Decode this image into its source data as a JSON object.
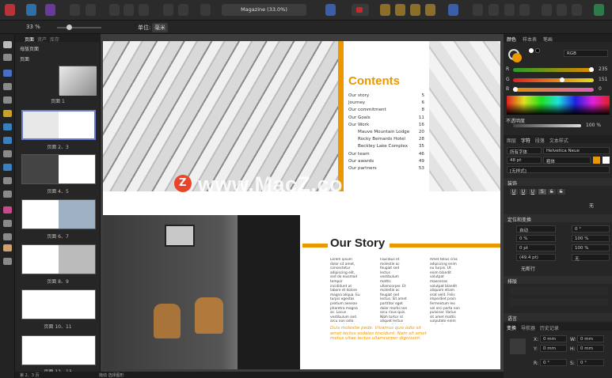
{
  "toolbar": {
    "doc_title": "Magazine (33.0%)"
  },
  "context": {
    "zoom": "33 %",
    "unit_label": "单位:",
    "unit_value": "毫米"
  },
  "pages_panel": {
    "tabs": [
      "页面",
      "资产",
      "库存"
    ],
    "master_label": "母版页面",
    "pages_label": "页面",
    "thumbs": [
      "页面 1",
      "页面 2、3",
      "页面 4、5",
      "页面 6、7",
      "页面 8、9",
      "页面 10、11",
      "页面 12、13"
    ]
  },
  "spread_toc": {
    "heading": "Contents",
    "items": [
      {
        "label": "Our story",
        "page": "5"
      },
      {
        "label": "Journey",
        "page": "6"
      },
      {
        "label": "Our commitment",
        "page": "8"
      },
      {
        "label": "Our Goals",
        "page": "11"
      },
      {
        "label": "Our Work",
        "page": "16"
      },
      {
        "label": "Mauve Mountain Lodge",
        "page": "20"
      },
      {
        "label": "Rocky Bernards Hotel",
        "page": "28"
      },
      {
        "label": "Beckley Lake Complex",
        "page": "35"
      },
      {
        "label": "Our team",
        "page": "46"
      },
      {
        "label": "Our awards",
        "page": "49"
      },
      {
        "label": "Our partners",
        "page": "53"
      }
    ]
  },
  "spread_story": {
    "heading": "Our Story",
    "col1": "Lorem ipsum dolor sit amet, consectetur adipiscing elit, sed do eiusmod tempor incididunt ut labore et dolore magna aliqua. Eu turpis egestas pretium aenean pharetra magna ac. Lacus vestibulum sed arcu non odio euismod lacinia. Tempus imperdiet nulla malesuada pellentesque elit eget gravida cum sociis natoque penatibus. Aliquam sem et tortor consequat id porta nibh venenatis cras sed felis eget.",
    "col2": "Faucibus et molestie ac feugiat sed lectus vestibulum mattis ullamcorper. Et molestie ac feugiat sed lectus. Sit amet porttitor eget dolor morbi non arcu risus quis. Nibh tortor id aliquet lectus proin nibh nisl condimentum id venenatis a. Cursus turpis massa tincidunt dui ut ornare lectus sit amet. Mauris sit amet massa vitae tortor condimentum lacinia quis vel eros.",
    "col3": "Amet tellus cras adipiscing enim eu turpis. Ut enim blandit volutpat maecenas volutpat blandit aliquam etiam erat velit. Felis imperdiet proin fermentum leo vel orci porta non pulvinar. Varius sit amet mattis vulputate enim nulla aliquet porttitor. Egestas maecenas pharetra convallis posuere morbi leo urna molestie.",
    "quote": "Duis molestie pede. Vivamus quis odio sit amet lectus sodales tincidunt. Nam sit amet metus vitae lectus ullamcorper dignissim."
  },
  "watermark": "www.MacZ.com",
  "right_panel": {
    "tabs1": [
      "颜色",
      "样本表",
      "笔画"
    ],
    "color_mode": "RGB",
    "r_label": "R",
    "r_value": "235",
    "g_label": "G",
    "g_value": "151",
    "b_label": "B",
    "b_value": "0",
    "opacity_label": "不透明度",
    "opacity_value": "100 %",
    "tabs2": [
      "图层",
      "字符",
      "段落",
      "文本样式"
    ],
    "font_lang": "所有字体",
    "font_name": "Helvetica Neue",
    "font_size": "48 pt",
    "font_style": "粗体",
    "no_style": "[无样式]",
    "decorations_label": "装饰",
    "none_label": "无",
    "positioning_label": "定位和变换",
    "auto_label": "自动",
    "kern_value": "0 %",
    "angle_value": "0 °",
    "scale_h": "100 %",
    "baseline_value": "0 pt",
    "scale_v": "100 %",
    "leading_value": "(49.4 pt)",
    "rotate_value": "无",
    "no_break": "无断行",
    "typography_label": "排版",
    "language_label": "语言",
    "tabs3": [
      "变换",
      "导航器",
      "历史记录"
    ],
    "x_label": "X:",
    "x_value": "0 mm",
    "y_label": "Y:",
    "y_value": "0 mm",
    "w_label": "W:",
    "w_value": "0 mm",
    "h_label": "H:",
    "h_value": "0 mm",
    "r2_label": "R:",
    "r2_value": "0 °",
    "s_label": "S:",
    "s_value": "0 °"
  },
  "status": {
    "page": "第 2、3 页",
    "hint": "拖动 选择图形"
  },
  "colors": {
    "accent": "#eb9700",
    "panel": "#262626",
    "selection": "#6a7bd0"
  }
}
